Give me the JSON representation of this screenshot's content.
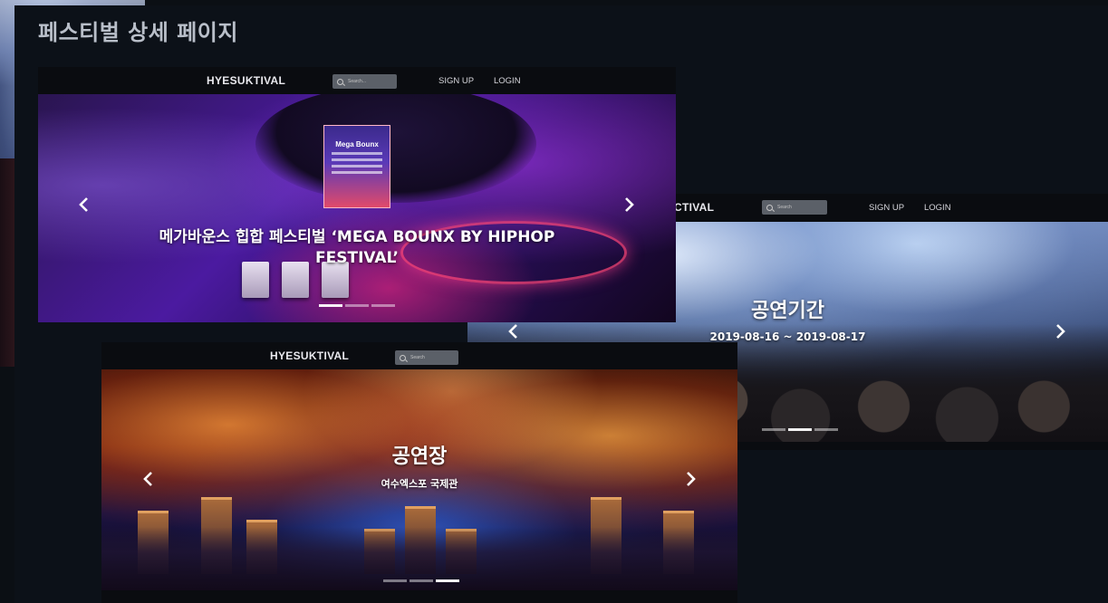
{
  "page": {
    "title": "페스티벌 상세 페이지"
  },
  "shots": {
    "main": {
      "brand": "HYESUKTIVAL",
      "search_placeholder": "Search...",
      "nav": {
        "signup": "SIGN UP",
        "login": "LOGIN"
      },
      "caption_line1": "메가바운스 힙합 페스티벌 ‘MEGA BOUNX BY HIPHOP",
      "caption_line2": "FESTIVAL’",
      "poster_text": "Mega Bounx",
      "indicators": {
        "count": 3,
        "active": 0
      }
    },
    "period": {
      "brand": "CTIVAL",
      "search_placeholder": "Search",
      "nav": {
        "signup": "SIGN UP",
        "login": "LOGIN"
      },
      "heading": "공연기간",
      "dates": "2019-08-16 ~ 2019-08-17",
      "indicators": {
        "count": 3,
        "active": 1
      }
    },
    "venue": {
      "brand": "HYESUKTIVAL",
      "search_placeholder": "Search",
      "heading": "공연장",
      "venue_name": "여수엑스포 국제관",
      "indicators": {
        "count": 3,
        "active": 2
      }
    }
  },
  "icons": {
    "prev": "chevron-left-icon",
    "next": "chevron-right-icon",
    "search": "search-icon"
  },
  "colors": {
    "background": "#0c1118",
    "title": "#b9bfc9",
    "navbar": "#0a0c10"
  }
}
